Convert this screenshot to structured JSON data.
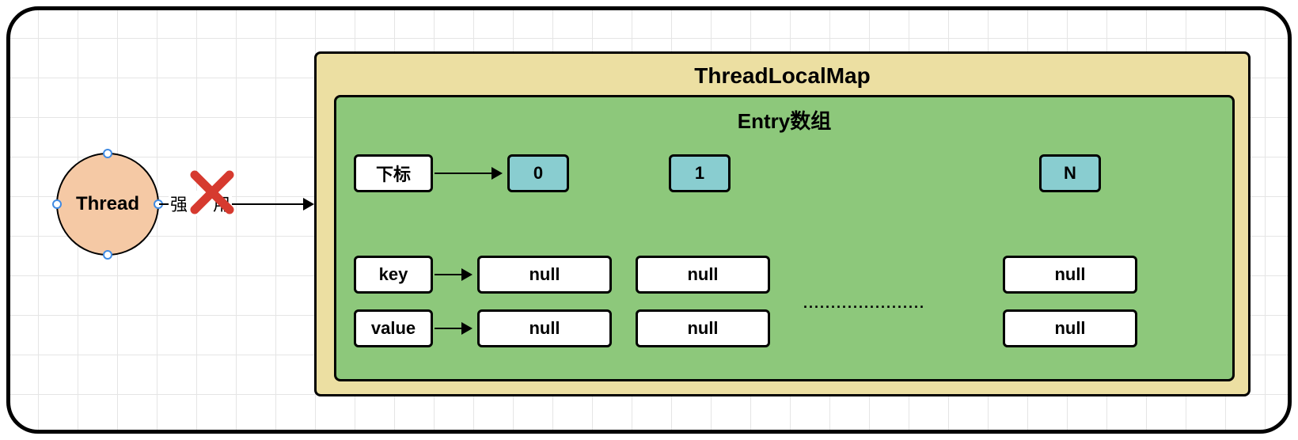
{
  "thread": {
    "label": "Thread"
  },
  "reference": {
    "c1": "强",
    "c2": "用"
  },
  "map": {
    "title": "ThreadLocalMap"
  },
  "entry": {
    "title": "Entry数组",
    "index_label": "下标",
    "key_label": "key",
    "value_label": "value",
    "indices": [
      "0",
      "1",
      "N"
    ],
    "keys": [
      "null",
      "null",
      "null"
    ],
    "values": [
      "null",
      "null",
      "null"
    ],
    "ellipsis": "......................"
  }
}
